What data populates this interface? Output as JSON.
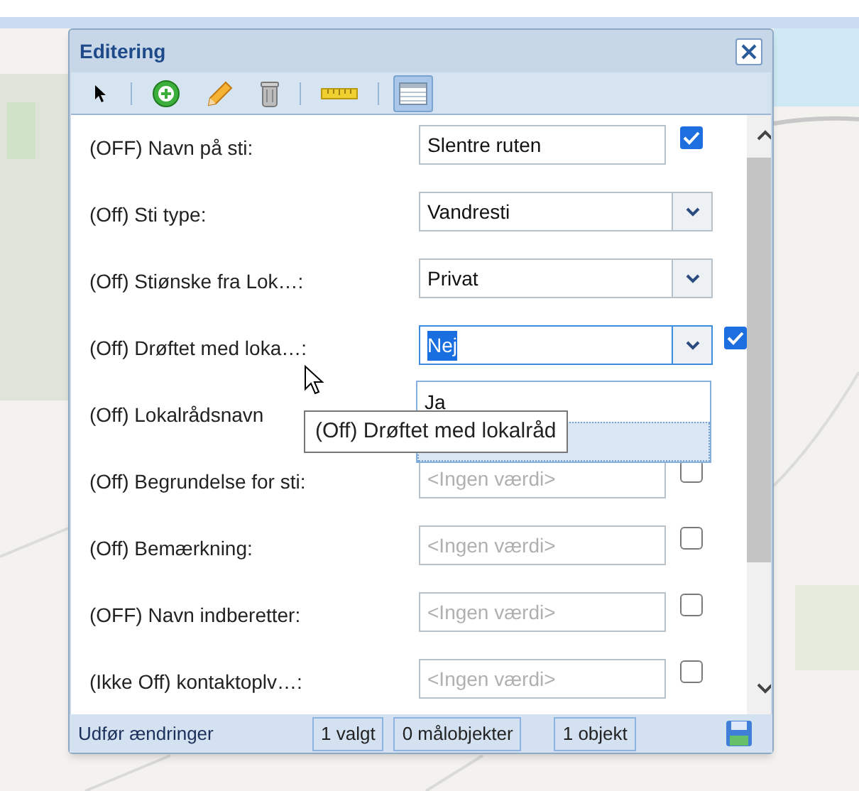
{
  "window": {
    "title": "Editering"
  },
  "toolbar": [
    {
      "kind": "pointer",
      "selected": false
    },
    {
      "kind": "add",
      "selected": false
    },
    {
      "kind": "edit",
      "selected": false
    },
    {
      "kind": "delete",
      "selected": false
    },
    {
      "kind": "measure",
      "selected": false
    },
    {
      "kind": "table",
      "selected": true
    }
  ],
  "fields": [
    {
      "label": "(OFF) Navn på sti:",
      "kind": "text",
      "value": "Slentre ruten",
      "checked": true
    },
    {
      "label": "(Off) Sti type:",
      "kind": "select",
      "value": "Vandresti"
    },
    {
      "label": "(Off) Stiønske fra Lok…:",
      "kind": "select",
      "value": "Privat"
    },
    {
      "label": "(Off) Drøftet med loka…:",
      "kind": "select",
      "value": "Nej",
      "focused": true,
      "checked": true
    },
    {
      "label": "(Off) Lokalrådsnavn",
      "kind": "covered"
    },
    {
      "label": "(Off) Begrundelse for sti:",
      "kind": "text",
      "placeholder": "<Ingen værdi>",
      "checked": false
    },
    {
      "label": "(Off) Bemærkning:",
      "kind": "text",
      "placeholder": "<Ingen værdi>",
      "checked": false
    },
    {
      "label": "(OFF) Navn indberetter:",
      "kind": "text",
      "placeholder": "<Ingen værdi>",
      "checked": false
    },
    {
      "label": "(Ikke Off) kontaktoplv…:",
      "kind": "text",
      "placeholder": "<Ingen værdi>",
      "checked": false
    }
  ],
  "dropdown": {
    "options": [
      {
        "label": "Ja",
        "selected": false
      },
      {
        "selected": true
      }
    ]
  },
  "tooltip": {
    "text": "(Off) Drøftet med lokalråd"
  },
  "footer": {
    "action": "Udfør ændringer",
    "counts": [
      "1 valgt",
      "0 målobjekter",
      "1 objekt"
    ]
  }
}
